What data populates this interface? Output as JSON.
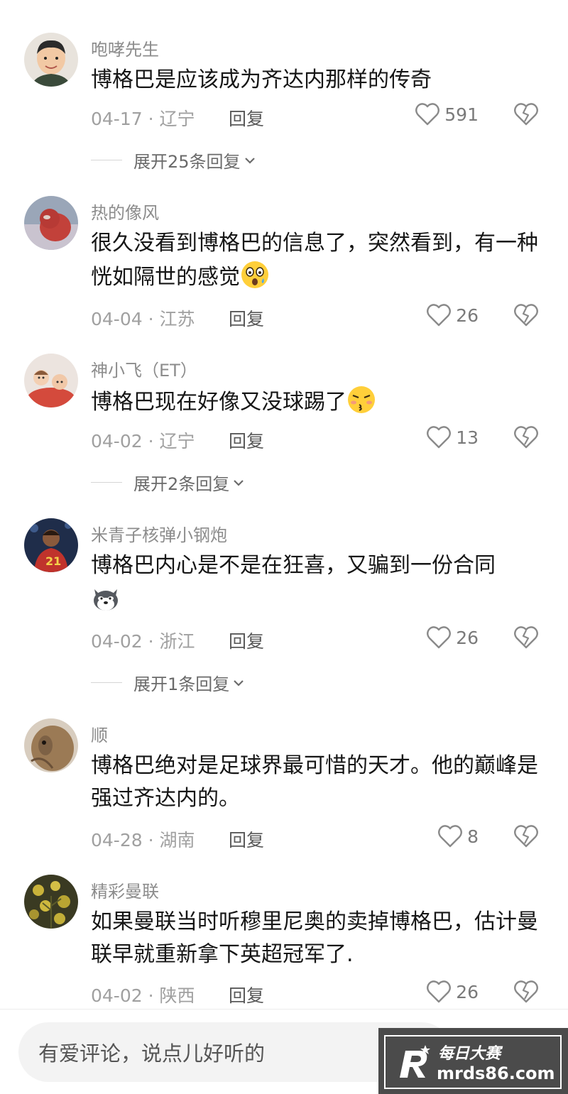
{
  "top_cut_text": "  ",
  "comments": [
    {
      "username": "咆哮先生",
      "text": "博格巴是应该成为齐达内那样的传奇",
      "date": "04-17",
      "region": "辽宁",
      "likes": "591",
      "reply_label": "回复",
      "expand_label": "展开25条回复"
    },
    {
      "username": "热的像风",
      "text": "很久没看到博格巴的信息了，突然看到，有一种恍如隔世的感觉",
      "date": "04-04",
      "region": "江苏",
      "likes": "26",
      "reply_label": "回复"
    },
    {
      "username": "神小飞（ET）",
      "text": "博格巴现在好像又没球踢了",
      "date": "04-02",
      "region": "辽宁",
      "likes": "13",
      "reply_label": "回复",
      "expand_label": "展开2条回复"
    },
    {
      "username": "米青子核弹小钢炮",
      "text": "博格巴内心是不是在狂喜，又骗到一份合同",
      "date": "04-02",
      "region": "浙江",
      "likes": "26",
      "reply_label": "回复",
      "expand_label": "展开1条回复"
    },
    {
      "username": "顺",
      "text": "博格巴绝对是足球界最可惜的天才。他的巅峰是强过齐达内的。",
      "date": "04-28",
      "region": "湖南",
      "likes": "8",
      "reply_label": "回复"
    },
    {
      "username": "精彩曼联",
      "text": "如果曼联当时听穆里尼奥的卖掉博格巴，估计曼联早就重新拿下英超冠军了.",
      "date": "04-02",
      "region": "陕西",
      "likes": "26",
      "reply_label": "回复"
    }
  ],
  "input_placeholder": "有爱评论，说点儿好听的",
  "watermark": {
    "brand": "每日大赛",
    "url": "mrds86.com"
  },
  "icons": {
    "like": "heart-outline-icon",
    "dislike": "broken-heart-icon",
    "expand": "chevron-down-icon"
  }
}
